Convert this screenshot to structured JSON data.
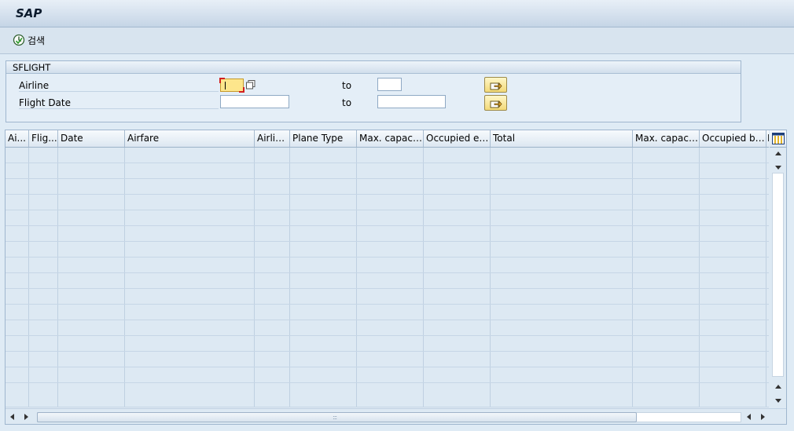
{
  "window": {
    "title": "SAP"
  },
  "toolbar": {
    "search_label": "검색",
    "search_icon": "execute-clock-icon"
  },
  "selection": {
    "group_title": "SFLIGHT",
    "airline": {
      "label": "Airline",
      "from_value": "",
      "to_label": "to",
      "to_value": ""
    },
    "flight_date": {
      "label": "Flight Date",
      "from_value": "",
      "to_label": "to",
      "to_value": ""
    }
  },
  "grid": {
    "columns": [
      "Ai...",
      "Flig...",
      "Date",
      "Airfare",
      "Airlin...",
      "Plane Type",
      "Max. capacit...",
      "Occupied ec...",
      "Total",
      "Max. capacit...",
      "Occupied bus.",
      "M"
    ],
    "row_count": 16
  },
  "colors": {
    "accent": "#f3d978",
    "active_field": "#fde68c",
    "background": "#dfebf5"
  }
}
